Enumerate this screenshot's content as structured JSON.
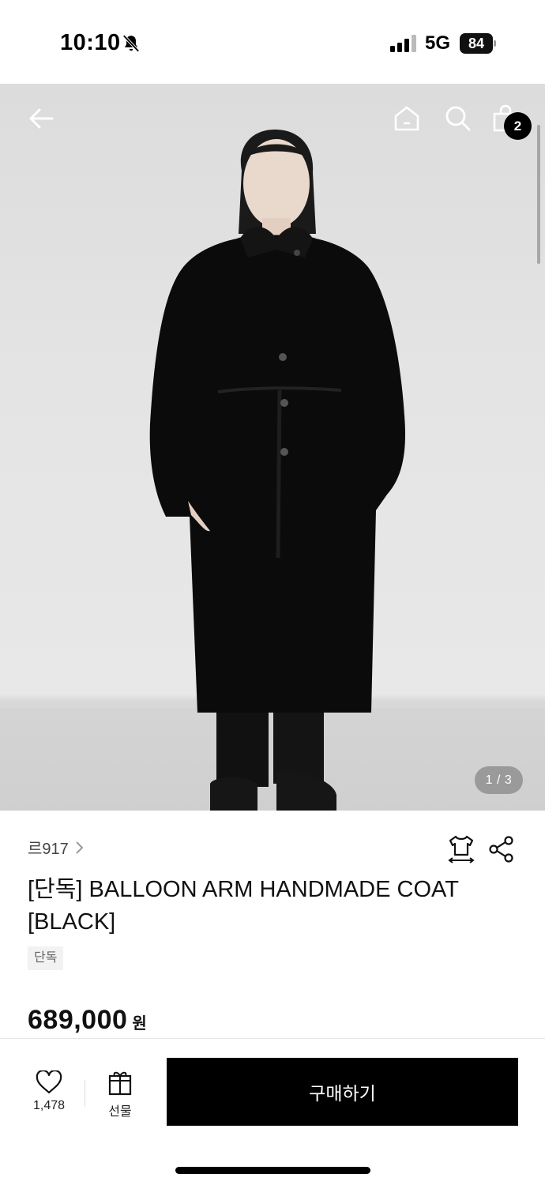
{
  "status_bar": {
    "time": "10:10",
    "network": "5G",
    "battery": "84"
  },
  "hero": {
    "image_counter": "1 / 3",
    "cart_count": "2"
  },
  "product": {
    "brand": "르917",
    "title": "[단독] BALLOON ARM HANDMADE COAT [BLACK]",
    "tag": "단독",
    "price": "689,000",
    "price_unit": "원"
  },
  "bottom_bar": {
    "like_count": "1,478",
    "gift_label": "선물",
    "buy_label": "구매하기"
  },
  "icons": {
    "back": "arrow-left-icon",
    "home": "home-icon",
    "search": "search-icon",
    "cart": "shopping-bag-icon",
    "size": "size-guide-icon",
    "share": "share-icon",
    "like": "heart-icon",
    "gift": "gift-icon"
  },
  "colors": {
    "primary": "#000000",
    "background": "#ffffff",
    "tag_bg": "#f2f2f2"
  }
}
